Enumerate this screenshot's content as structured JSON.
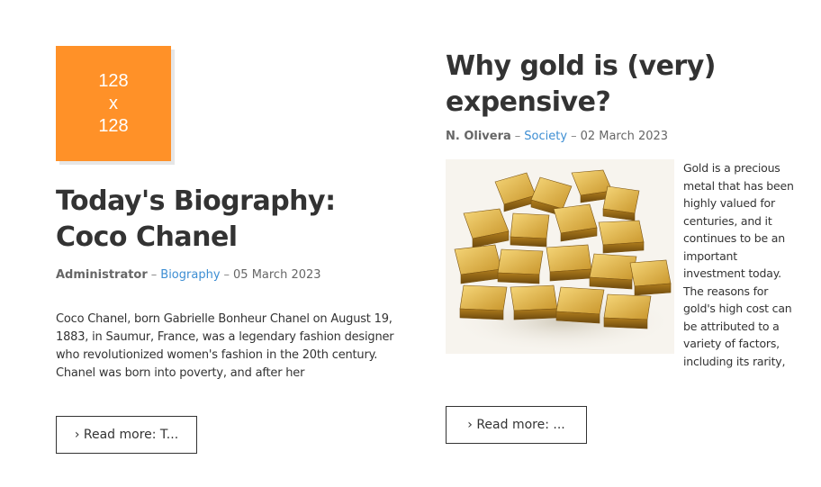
{
  "articles": [
    {
      "thumbnail": {
        "line1": "128",
        "line2": "x",
        "line3": "128",
        "color": "#ff9128"
      },
      "title": "Today's Biography: Coco Chanel",
      "author": "Administrator",
      "separator": "–",
      "category": "Biography",
      "date": "05 March 2023",
      "excerpt": "Coco Chanel, born Gabrielle Bonheur Chanel on August 19, 1883, in Saumur, France, was a legendary fashion designer who revolutionized women's fashion in the 20th century. Chanel was born into poverty, and after her",
      "read_more": "› Read more: T..."
    },
    {
      "image_icon": "gold-bars-image",
      "title": "Why gold is (very) expensive?",
      "author": "N. Olivera",
      "separator": "–",
      "category": "Society",
      "date": "02 March 2023",
      "excerpt": "Gold is a precious metal that has been highly valued for centuries, and it continues to be an important investment today. The reasons for gold's high cost can be attributed to a variety of factors, including its rarity,",
      "read_more": "› Read more: ..."
    }
  ],
  "colors": {
    "accent_link": "#3d8ed3",
    "text": "#333333",
    "meta": "#666666"
  }
}
